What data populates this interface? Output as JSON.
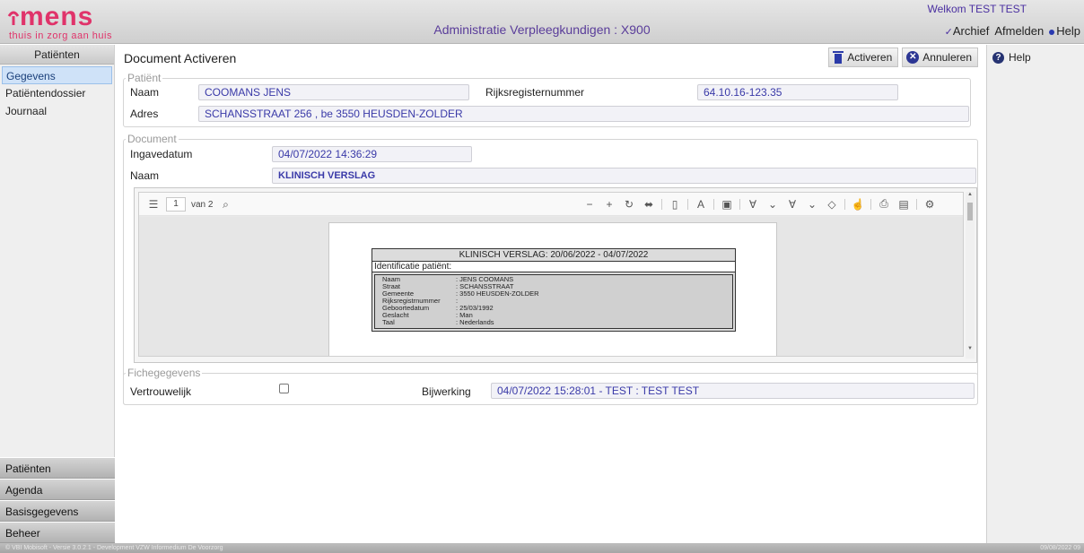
{
  "header": {
    "logo_text": "mens",
    "logo_tagline": "thuis in zorg aan huis",
    "app_title": "Administratie Verpleegkundigen : X900",
    "welcome": "Welkom TEST TEST",
    "links": {
      "archief": "Archief",
      "afmelden": "Afmelden",
      "help": "Help"
    }
  },
  "sidebar": {
    "header": "Patiënten",
    "items": [
      {
        "label": "Gegevens"
      },
      {
        "label": "Patiëntendossier"
      },
      {
        "label": "Journaal"
      }
    ],
    "bottom": [
      {
        "label": "Patiënten"
      },
      {
        "label": "Agenda"
      },
      {
        "label": "Basisgegevens"
      },
      {
        "label": "Beheer"
      }
    ]
  },
  "main": {
    "title": "Document Activeren",
    "toolbar": {
      "activeren": "Activeren",
      "annuleren": "Annuleren"
    },
    "patient": {
      "legend": "Patiënt",
      "naam_label": "Naam",
      "naam": "COOMANS JENS",
      "rrn_label": "Rijksregisternummer",
      "rrn": "64.10.16-123.35",
      "adres_label": "Adres",
      "adres": "SCHANSSTRAAT 256 , be 3550 HEUSDEN-ZOLDER"
    },
    "document": {
      "legend": "Document",
      "ingavedatum_label": "Ingavedatum",
      "ingavedatum": "04/07/2022 14:36:29",
      "naam_label": "Naam",
      "naam": "KLINISCH VERSLAG"
    },
    "pdf": {
      "page": "1",
      "page_of": "van 2",
      "report_title": "KLINISCH VERSLAG: 20/06/2022 - 04/07/2022",
      "section": "Identificatie patiënt:",
      "rows": [
        {
          "k": "Naam",
          "v": ": JENS COOMANS"
        },
        {
          "k": "Straat",
          "v": ": SCHANSSTRAAT"
        },
        {
          "k": "Gemeente",
          "v": ": 3550 HEUSDEN-ZOLDER"
        },
        {
          "k": "Rijksregistrnummer",
          "v": ":"
        },
        {
          "k": "Geboortedatum",
          "v": ": 25/03/1992"
        },
        {
          "k": "Geslacht",
          "v": ": Man"
        },
        {
          "k": "Taal",
          "v": ": Nederlands"
        }
      ]
    },
    "fiche": {
      "legend": "Fichegegevens",
      "vertrouwelijk_label": "Vertrouwelijk",
      "vertrouwelijk_checked": false,
      "bijwerking_label": "Bijwerking",
      "bijwerking": "04/07/2022 15:28:01 - TEST : TEST TEST"
    }
  },
  "right": {
    "help": "Help"
  },
  "footer": {
    "left": "© VBI Mobisoft - Versie 3.0.2.1 - Development VZW Informedium De Voorzorg",
    "right": "09/08/2022 09"
  },
  "colors": {
    "brand": "#e0336a",
    "accent": "#4a2fa0",
    "field_text": "#3a3aa8"
  }
}
